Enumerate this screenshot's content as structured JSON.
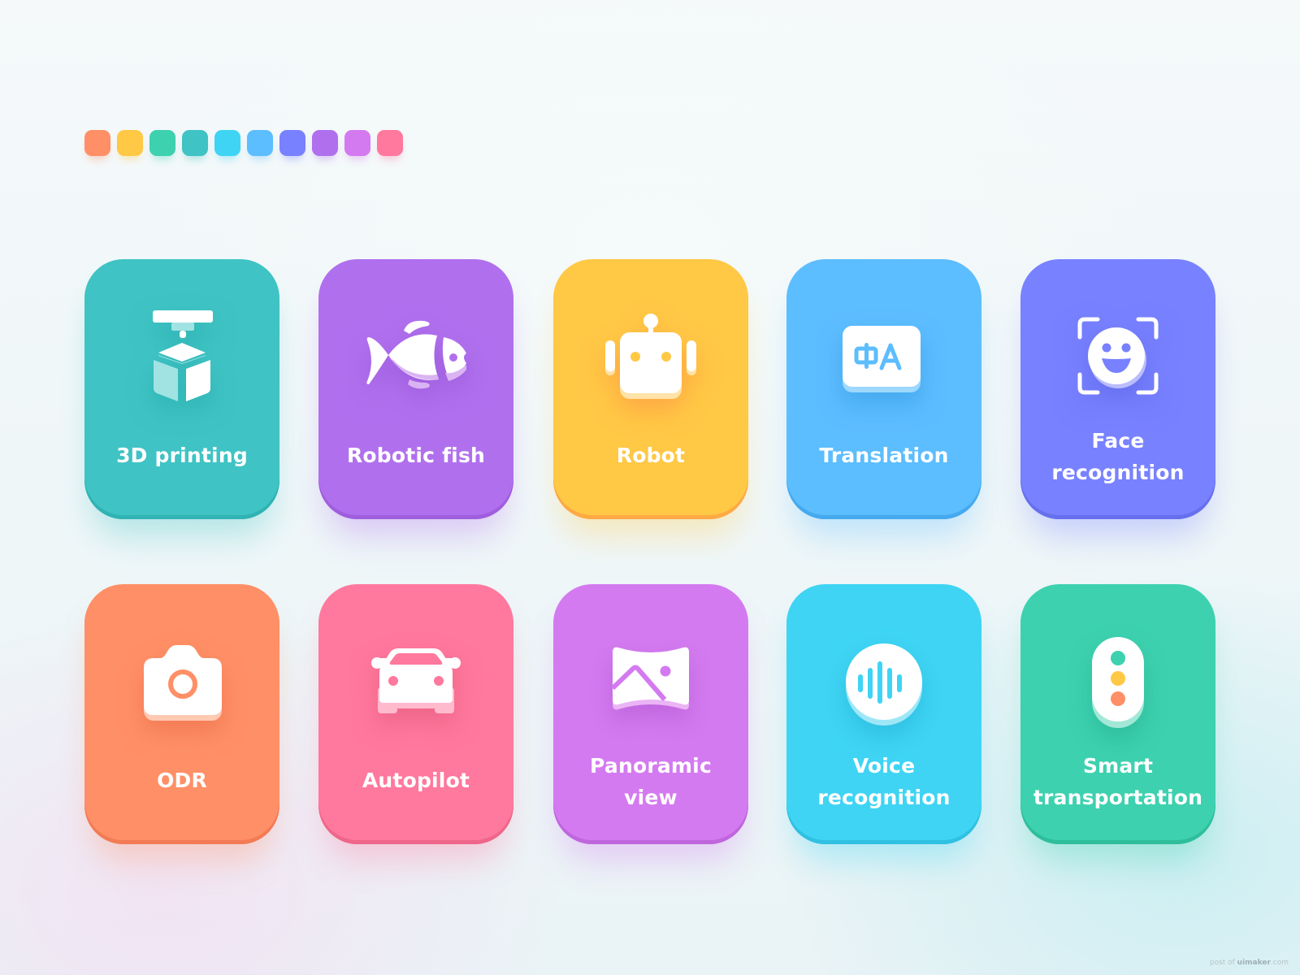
{
  "palette": [
    {
      "name": "orange",
      "color": "#FF8F66"
    },
    {
      "name": "yellow",
      "color": "#FFC845"
    },
    {
      "name": "green",
      "color": "#3DD1AF"
    },
    {
      "name": "teal",
      "color": "#3FC3C4"
    },
    {
      "name": "cyan",
      "color": "#3FD4F4"
    },
    {
      "name": "sky-blue",
      "color": "#5CBDFF"
    },
    {
      "name": "indigo",
      "color": "#7881FF"
    },
    {
      "name": "purple",
      "color": "#B070EE"
    },
    {
      "name": "violet",
      "color": "#D47AF0"
    },
    {
      "name": "pink",
      "color": "#FF789D"
    }
  ],
  "cards": [
    {
      "label": "3D printing",
      "icon": "3d-printer-icon",
      "color": "#3FC3C4",
      "edge": "#2FB3B3"
    },
    {
      "label": "Robotic fish",
      "icon": "fish-icon",
      "color": "#B070EE",
      "edge": "#9F5EDD"
    },
    {
      "label": "Robot",
      "icon": "robot-icon",
      "color": "#FFC845",
      "edge": "#FFA944"
    },
    {
      "label": "Translation",
      "icon": "translation-icon",
      "color": "#5CBDFF",
      "edge": "#45A9EE"
    },
    {
      "label_line1": "Face",
      "label_line2": "recognition",
      "icon": "face-recognition-icon",
      "color": "#7881FF",
      "edge": "#6670EE"
    },
    {
      "label": "ODR",
      "icon": "camera-icon",
      "color": "#FF8F66",
      "edge": "#F27B55"
    },
    {
      "label": "Autopilot",
      "icon": "car-icon",
      "color": "#FF789D",
      "edge": "#EE6689"
    },
    {
      "label_line1": "Panoramic",
      "label_line2": "view",
      "icon": "panorama-icon",
      "color": "#D47AF0",
      "edge": "#BF66DD"
    },
    {
      "label_line1": "Voice",
      "label_line2": "recognition",
      "icon": "voice-wave-icon",
      "color": "#3FD4F4",
      "edge": "#2FC0E2"
    },
    {
      "label_line1": "Smart",
      "label_line2": "transportation",
      "icon": "traffic-light-icon",
      "color": "#3DD1AF",
      "edge": "#2EBE9C"
    }
  ],
  "watermark": {
    "prefix": "post of",
    "brand": "uimaker",
    "suffix": ".com"
  }
}
